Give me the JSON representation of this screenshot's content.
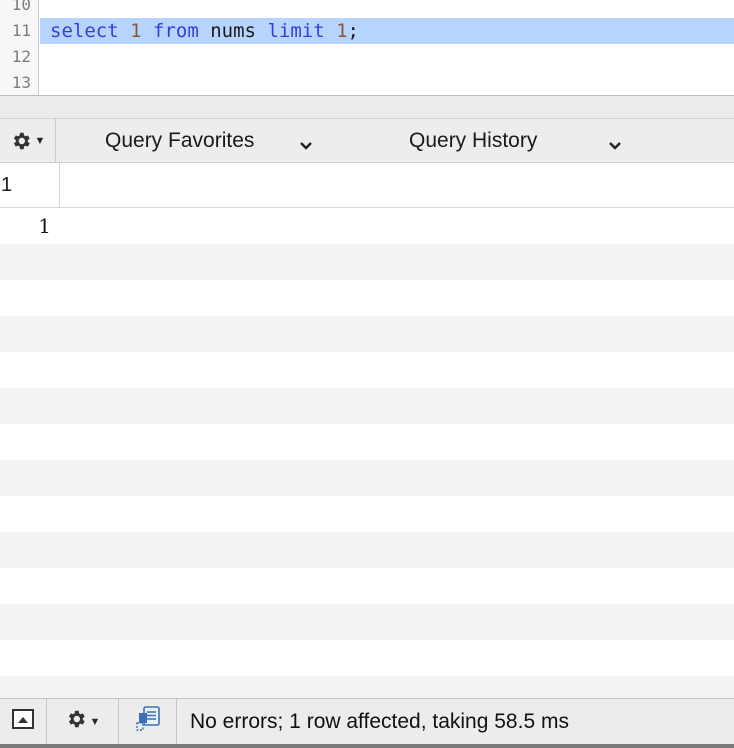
{
  "editor": {
    "lines": [
      {
        "number": "10",
        "tokens": []
      },
      {
        "number": "11",
        "selected": true,
        "tokens": [
          {
            "text": "select",
            "kind": "keyword"
          },
          {
            "text": " ",
            "kind": "space"
          },
          {
            "text": "1",
            "kind": "number"
          },
          {
            "text": " ",
            "kind": "space"
          },
          {
            "text": "from",
            "kind": "keyword"
          },
          {
            "text": " ",
            "kind": "space"
          },
          {
            "text": "nums",
            "kind": "identifier"
          },
          {
            "text": " ",
            "kind": "space"
          },
          {
            "text": "limit",
            "kind": "keyword"
          },
          {
            "text": " ",
            "kind": "space"
          },
          {
            "text": "1",
            "kind": "number"
          },
          {
            "text": ";",
            "kind": "identifier"
          }
        ]
      },
      {
        "number": "12",
        "tokens": []
      },
      {
        "number": "13",
        "tokens": []
      }
    ],
    "colors": {
      "keyword": "#3c3cdc",
      "number": "#8b5a2b",
      "selection": "#b5d5ff"
    }
  },
  "toolbar": {
    "gear_icon": "gear-icon",
    "favorites_label": "Query Favorites",
    "history_label": "Query History"
  },
  "results": {
    "columns": [
      "1"
    ],
    "rows": [
      [
        "1"
      ]
    ]
  },
  "statusbar": {
    "message": "No errors; 1 row affected, taking 58.5 ms"
  }
}
